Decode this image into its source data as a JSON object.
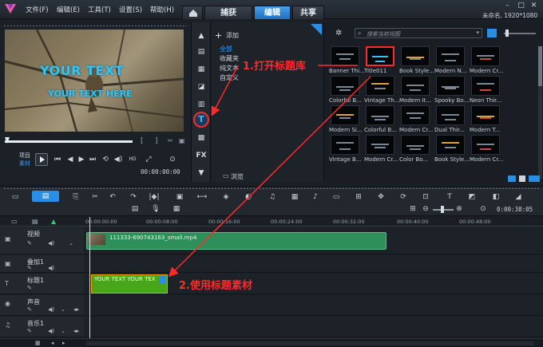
{
  "app": {
    "title": "未命名, 1920*1080"
  },
  "menu": [
    "文件(F)",
    "编辑(E)",
    "工具(T)",
    "设置(S)",
    "帮助(H)"
  ],
  "tabs": {
    "capture": "捕获",
    "edit": "编辑",
    "share": "共享"
  },
  "preview": {
    "overlay_line1": "YOUR TEXT",
    "overlay_line2": "YOUR TEXT HERE",
    "mode_project": "项目",
    "mode_clip": "素材",
    "timecode": "00:00:00:00"
  },
  "library": {
    "add_label": "添加",
    "categories": [
      "全部",
      "收藏夹",
      "纯文本",
      "自定义"
    ],
    "browse_label": "浏览",
    "search_placeholder": "搜索当前视图",
    "thumbs": [
      {
        "label": "Banner Thi...",
        "selected": false
      },
      {
        "label": "Title011",
        "selected": true
      },
      {
        "label": "Book Style...",
        "selected": false
      },
      {
        "label": "Modern N...",
        "selected": false
      },
      {
        "label": "Modern Cr...",
        "selected": false
      },
      {
        "label": "Colorful B...",
        "selected": false
      },
      {
        "label": "Vintage Th...",
        "selected": false
      },
      {
        "label": "Modern It...",
        "selected": false
      },
      {
        "label": "Spooky Bo...",
        "selected": false
      },
      {
        "label": "Neon Thir...",
        "selected": false
      },
      {
        "label": "Modern Si...",
        "selected": false
      },
      {
        "label": "Colorful B...",
        "selected": false
      },
      {
        "label": "Modern Cr...",
        "selected": false
      },
      {
        "label": "Dual Thir...",
        "selected": false
      },
      {
        "label": "Modern T...",
        "selected": false
      },
      {
        "label": "Vintage B...",
        "selected": false
      },
      {
        "label": "Modern Cr...",
        "selected": false
      },
      {
        "label": "Color Bo...",
        "selected": false
      },
      {
        "label": "Book Style...",
        "selected": false
      },
      {
        "label": "Modern Cr...",
        "selected": false
      }
    ]
  },
  "timeline": {
    "timecode": "0:00:38:05",
    "ticks": [
      "00:00:00:00",
      "00:00:08:00",
      "00:00:16:00",
      "00:00:24:00",
      "00:00:32:00",
      "00:00:40:00",
      "00:00:48:00"
    ],
    "tracks": [
      {
        "name": "视频"
      },
      {
        "name": "叠加1"
      },
      {
        "name": "标题1"
      },
      {
        "name": "声音"
      },
      {
        "name": "音乐1"
      }
    ],
    "video_clip_label": "111333-690743163_small.mp4",
    "title_clip_label": "YOUR TEXT YOUR TEX"
  },
  "annotations": {
    "step1": "1.打开标题库",
    "step2": "2.使用标题素材"
  },
  "colors": {
    "accent": "#2a8ee4",
    "annotation": "#ff2a2a",
    "video_clip": "#2f8f5a",
    "title_clip": "#49a51a"
  }
}
